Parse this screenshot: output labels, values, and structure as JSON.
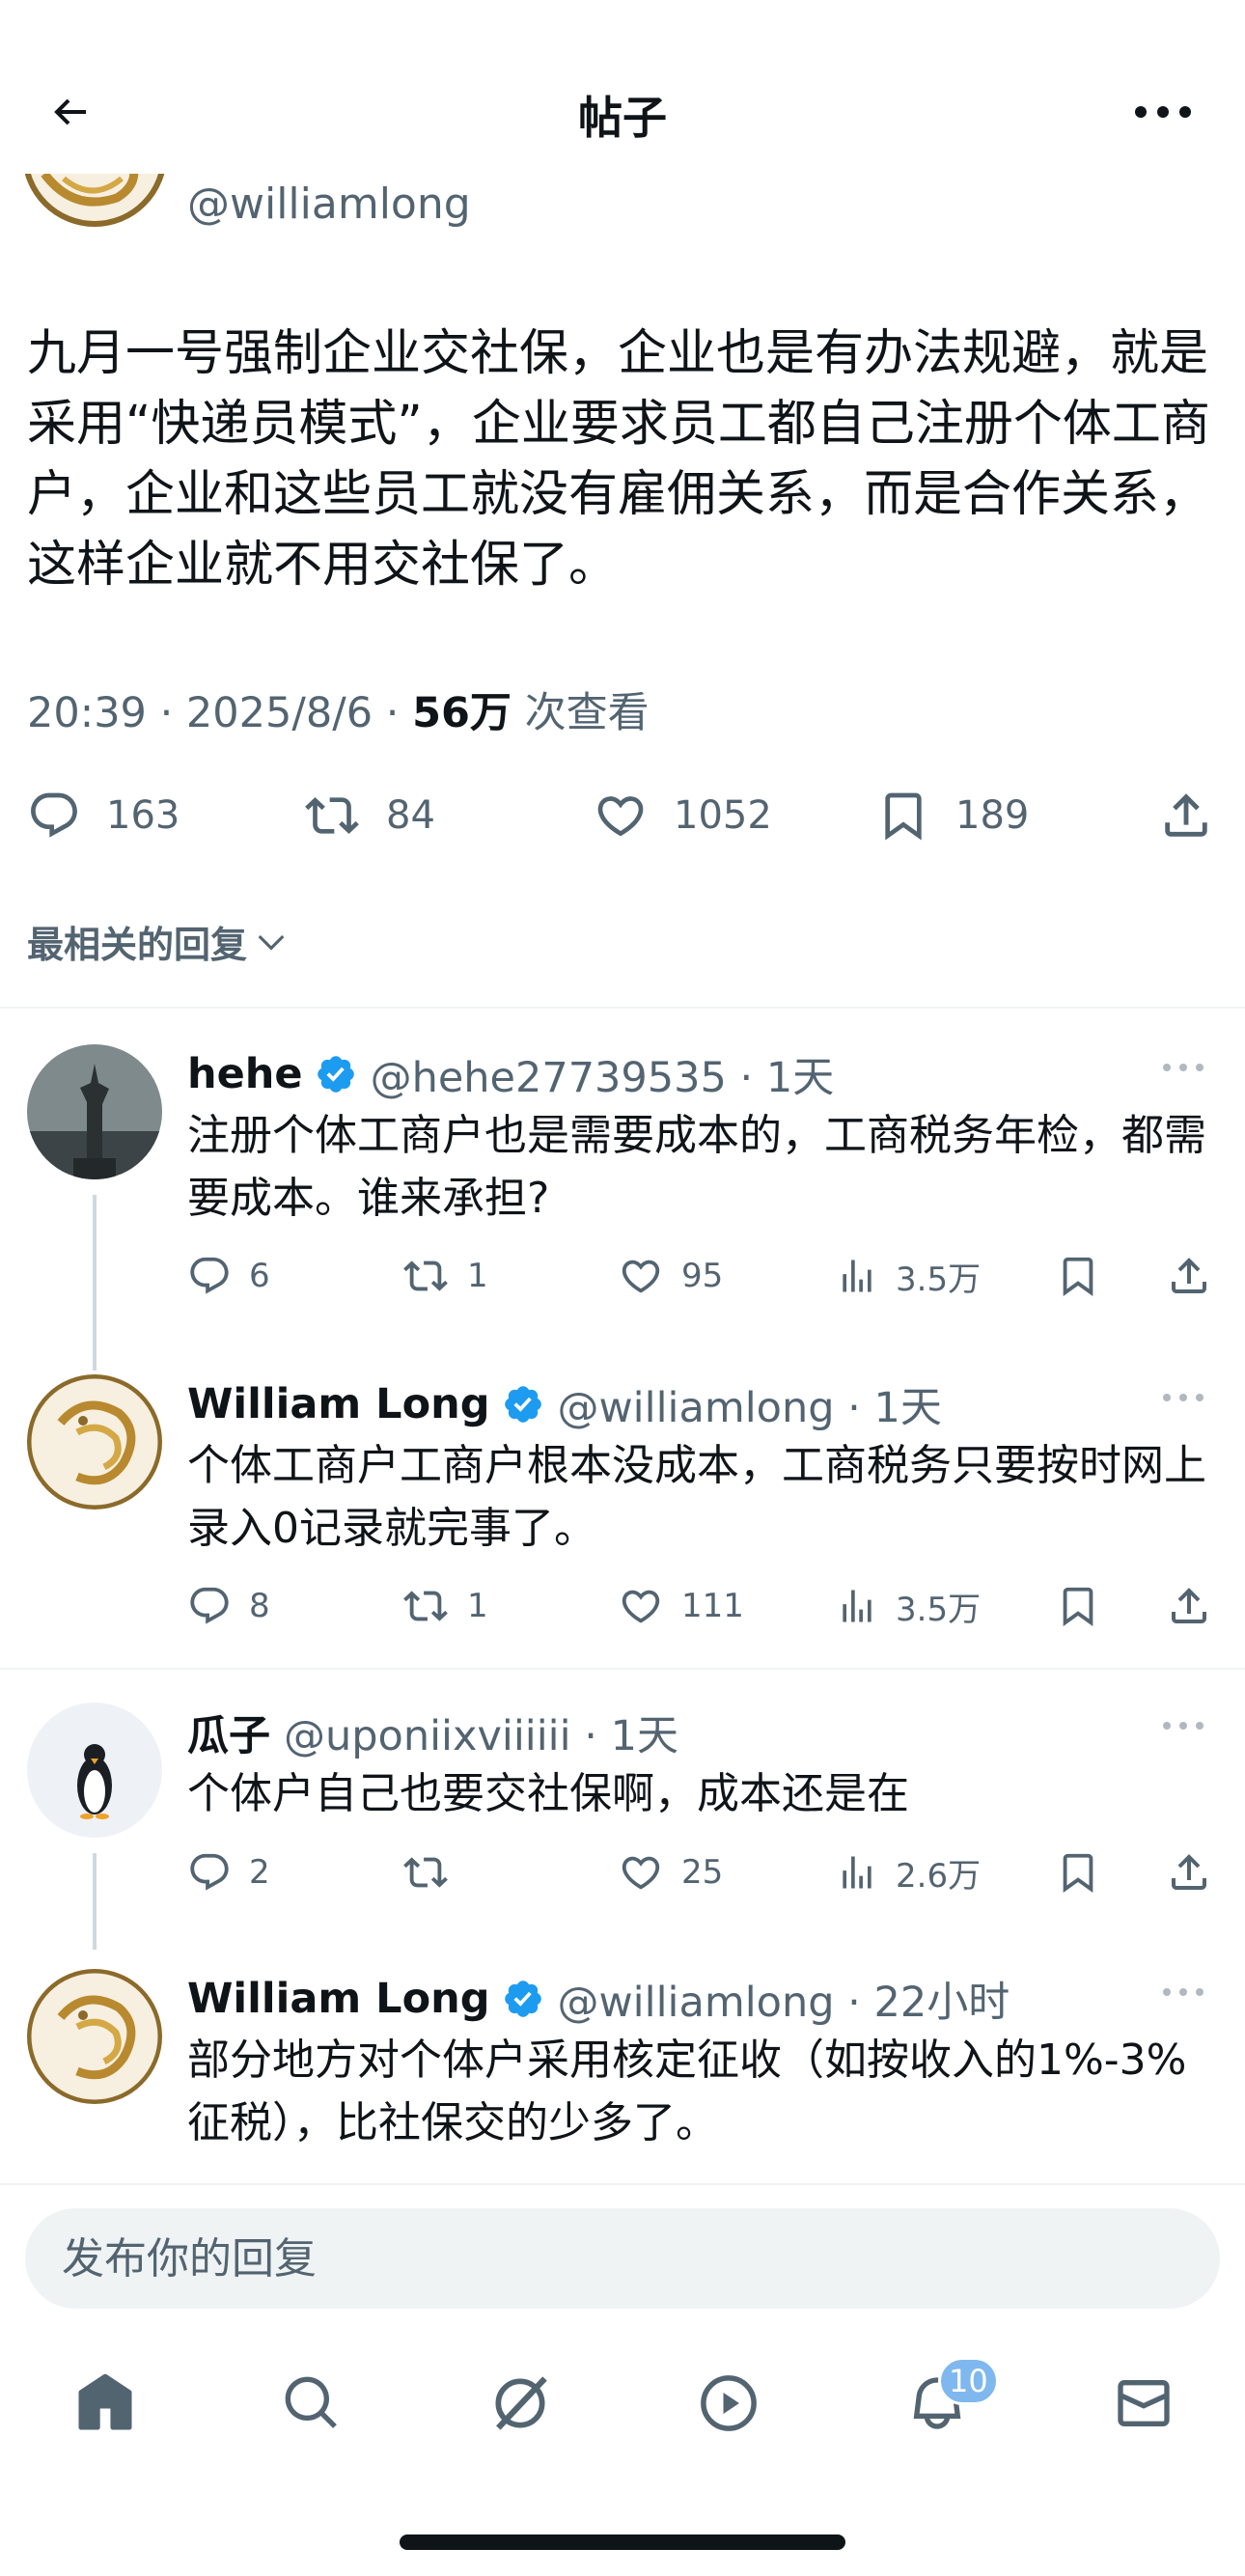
{
  "header": {
    "title": "帖子"
  },
  "tweet": {
    "handle": "@williamlong",
    "text": "九月一号强制企业交社保，企业也是有办法规避，就是采用“快递员模式”，企业要求员工都自己注册个体工商户，企业和这些员工就没有雇佣关系，而是合作关系，这样企业就不用交社保了。",
    "time": "20:39 · 2025/8/6 · ",
    "views": "56万",
    "views_label": " 次查看",
    "replies": "163",
    "retweets": "84",
    "likes": "1052",
    "bookmarks": "189"
  },
  "sort_label": "最相关的回复",
  "replies": [
    {
      "name": "hehe",
      "handle": "@hehe27739535 · 1天",
      "text": "注册个体工商户也是需要成本的，工商税务年检，都需要成本。谁来承担?",
      "replies": "6",
      "retweets": "1",
      "likes": "95",
      "views": "3.5万",
      "avatar": "statue-of-liberty"
    },
    {
      "name": "William Long",
      "handle": "@williamlong · 1天",
      "text": "个体工商户工商户根本没成本，工商税务只要按时网上录入0记录就完事了。",
      "replies": "8",
      "retweets": "1",
      "likes": "111",
      "views": "3.5万",
      "avatar": "golden-dragon"
    },
    {
      "name": "瓜子",
      "handle": "@uponiixviiiiii · 1天",
      "text": "个体户自己也要交社保啊，成本还是在",
      "replies": "2",
      "retweets": "",
      "likes": "25",
      "views": "2.6万",
      "avatar": "penguin"
    },
    {
      "name": "William Long",
      "handle": "@williamlong · 22小时",
      "text": "部分地方对个体户采用核定征收（如按收入的1%-3%征税），比社保交的少多了。",
      "avatar": "golden-dragon"
    }
  ],
  "composer": {
    "placeholder": "发布你的回复"
  },
  "nav": {
    "notifications_badge": "10"
  },
  "colors": {
    "accent": "#1d9bf0",
    "secondary_text": "#536471",
    "badge": "#7fb8ee"
  }
}
